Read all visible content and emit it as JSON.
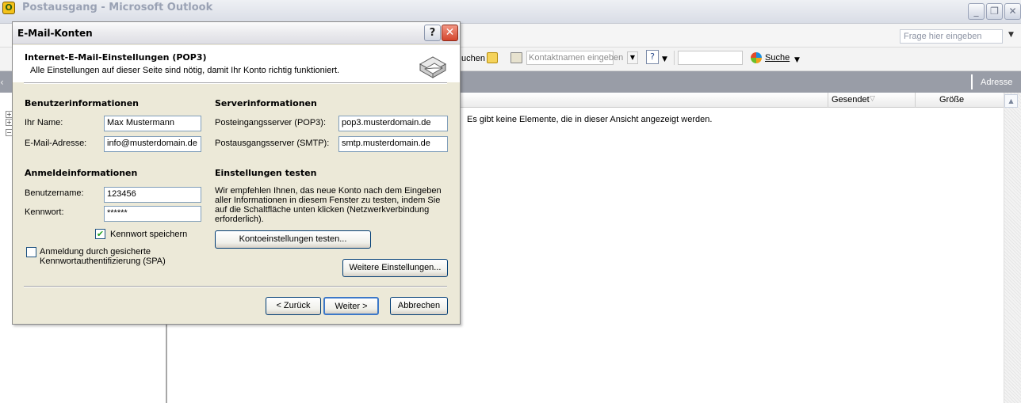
{
  "outlook": {
    "title": "Postausgang - Microsoft Outlook",
    "help_placeholder": "Frage hier eingeben",
    "toolbar": {
      "search_fragment": "uchen",
      "contacts_placeholder": "Kontaktnamen eingeben",
      "search_label": "Suche"
    },
    "header_label": "Adresse",
    "columns": {
      "sent": "Gesendet",
      "size": "Größe"
    },
    "empty_message": "Es gibt keine Elemente, die in dieser Ansicht angezeigt werden.",
    "colors": {
      "folder_header": "#999da7",
      "dialog_bg": "#ece9d8"
    }
  },
  "dialog": {
    "title": "E-Mail-Konten",
    "heading": "Internet-E-Mail-Einstellungen (POP3)",
    "subheading": "Alle Einstellungen auf dieser Seite sind nötig, damit Ihr Konto richtig funktioniert.",
    "user_info": {
      "title": "Benutzerinformationen",
      "name_label": "Ihr Name:",
      "name_value": "Max Mustermann",
      "email_label": "E-Mail-Adresse:",
      "email_value": "info@musterdomain.de"
    },
    "server_info": {
      "title": "Serverinformationen",
      "incoming_label": "Posteingangsserver (POP3):",
      "incoming_value": "pop3.musterdomain.de",
      "outgoing_label": "Postausgangsserver (SMTP):",
      "outgoing_value": "smtp.musterdomain.de"
    },
    "login_info": {
      "title": "Anmeldeinformationen",
      "username_label": "Benutzername:",
      "username_value": "123456",
      "password_label": "Kennwort:",
      "password_value": "******",
      "remember_label": "Kennwort speichern",
      "remember_checked": "✔",
      "spa_label": "Anmeldung durch gesicherte Kennwortauthentifizierung (SPA)"
    },
    "test": {
      "title": "Einstellungen testen",
      "description": "Wir empfehlen Ihnen, das neue Konto nach dem Eingeben aller Informationen in diesem Fenster zu testen, indem Sie auf die Schaltfläche unten klicken (Netzwerkverbindung erforderlich).",
      "button": "Kontoeinstellungen testen..."
    },
    "more_settings_button": "Weitere Einstellungen...",
    "back_button": "< Zurück",
    "next_button": "Weiter >",
    "cancel_button": "Abbrechen"
  }
}
